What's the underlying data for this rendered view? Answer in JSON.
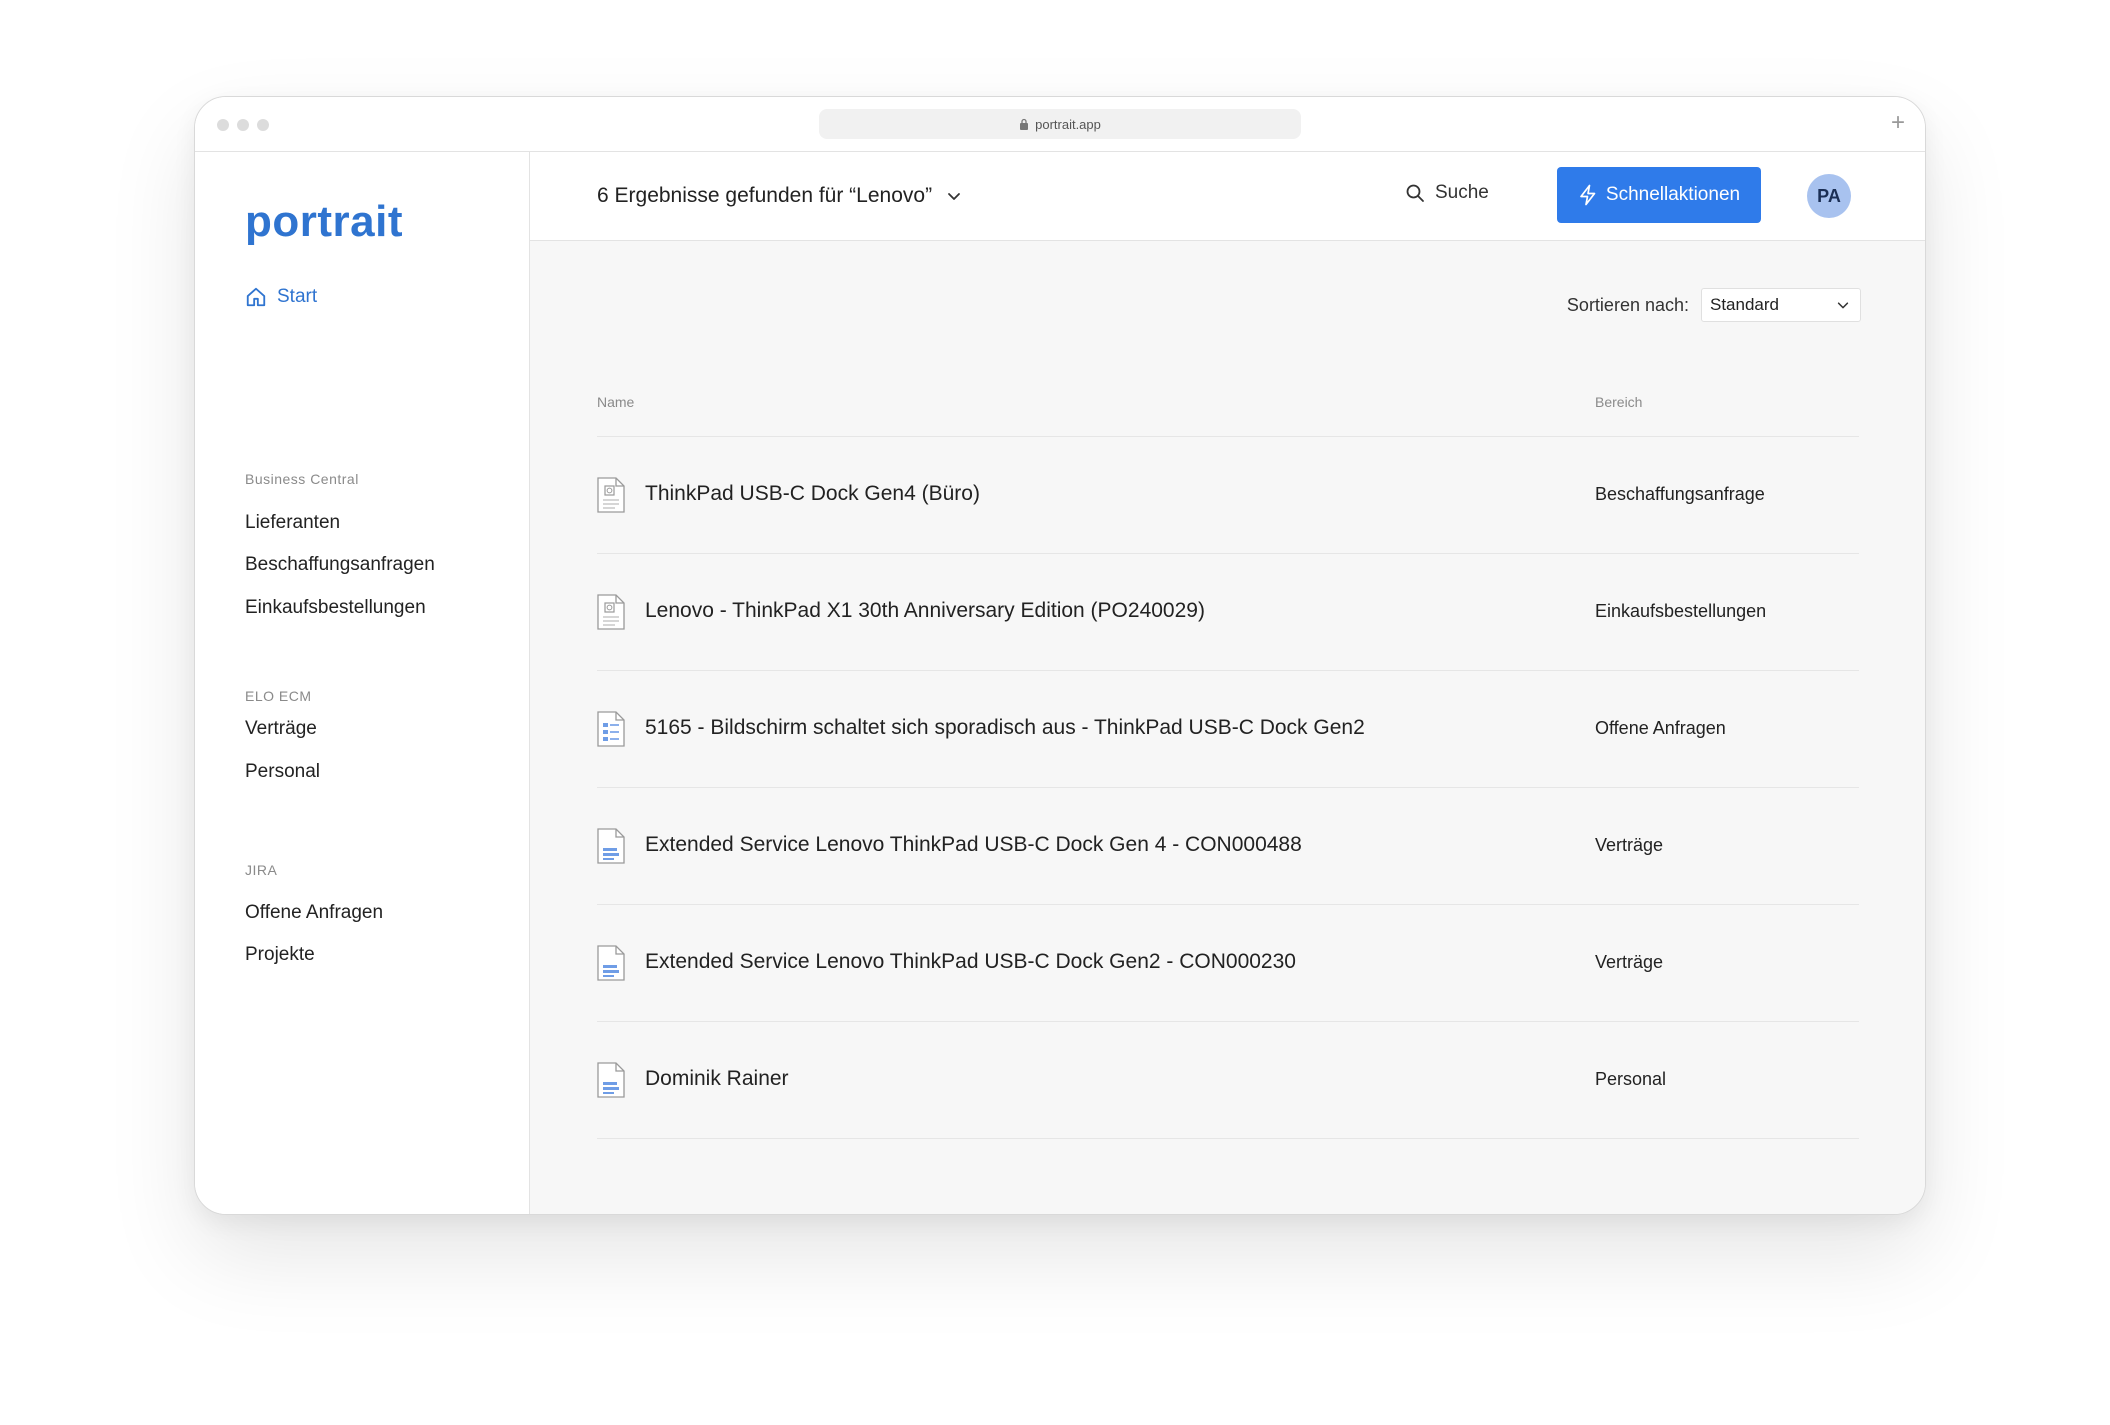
{
  "browser": {
    "url": "portrait.app"
  },
  "sidebar": {
    "logo": "portrait",
    "start_label": "Start",
    "sections": [
      {
        "label": "Business Central",
        "items": [
          "Lieferanten",
          "Beschaffungsanfragen",
          "Einkaufsbestellungen"
        ]
      },
      {
        "label": "ELO ECM",
        "items": [
          "Verträge",
          "Personal"
        ]
      },
      {
        "label": "JIRA",
        "items": [
          "Offene Anfragen",
          "Projekte"
        ]
      }
    ]
  },
  "header": {
    "results_title": "6 Ergebnisse gefunden für “Lenovo”",
    "search_label": "Suche",
    "quick_actions_label": "Schnellaktionen",
    "avatar_initials": "PA"
  },
  "sort": {
    "label": "Sortieren nach:",
    "selected": "Standard"
  },
  "table": {
    "columns": {
      "name": "Name",
      "area": "Bereich"
    },
    "rows": [
      {
        "name": "ThinkPad USB-C Dock Gen4 (Büro)",
        "area": "Beschaffungsanfrage",
        "icon": "procurement-doc-icon"
      },
      {
        "name": "Lenovo - ThinkPad X1 30th Anniversary Edition (PO240029)",
        "area": "Einkaufsbestellungen",
        "icon": "procurement-doc-icon"
      },
      {
        "name": "5165 - Bildschirm schaltet sich sporadisch aus - ThinkPad USB-C Dock Gen2",
        "area": "Offene Anfragen",
        "icon": "ticket-doc-icon"
      },
      {
        "name": "Extended Service Lenovo ThinkPad USB-C Dock Gen 4 - CON000488",
        "area": "Verträge",
        "icon": "contract-doc-icon"
      },
      {
        "name": "Extended Service Lenovo ThinkPad USB-C Dock Gen2 - CON000230",
        "area": "Verträge",
        "icon": "contract-doc-icon"
      },
      {
        "name": "Dominik Rainer",
        "area": "Personal",
        "icon": "contract-doc-icon"
      }
    ]
  },
  "colors": {
    "brand": "#2f74d0",
    "primary_button": "#2f7bea",
    "avatar_bg": "#a8c2ef"
  }
}
